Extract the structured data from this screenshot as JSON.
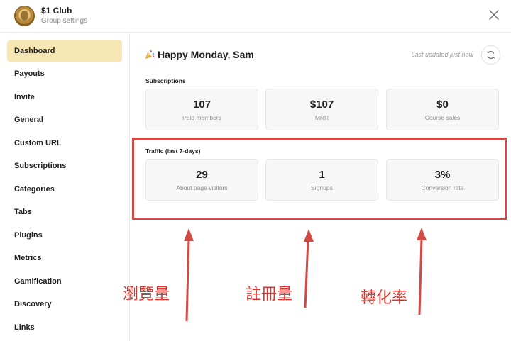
{
  "header": {
    "group_name": "$1 Club",
    "group_subtitle": "Group settings"
  },
  "sidebar": {
    "items": [
      {
        "label": "Dashboard",
        "active": true
      },
      {
        "label": "Payouts"
      },
      {
        "label": "Invite"
      },
      {
        "label": "General"
      },
      {
        "label": "Custom URL"
      },
      {
        "label": "Subscriptions"
      },
      {
        "label": "Categories"
      },
      {
        "label": "Tabs"
      },
      {
        "label": "Plugins"
      },
      {
        "label": "Metrics"
      },
      {
        "label": "Gamification"
      },
      {
        "label": "Discovery"
      },
      {
        "label": "Links"
      }
    ]
  },
  "main": {
    "greeting": "Happy Monday, Sam",
    "last_updated": "Last updated just now",
    "subscriptions": {
      "label": "Subscriptions",
      "cards": [
        {
          "value": "107",
          "label": "Paid members"
        },
        {
          "value": "$107",
          "label": "MRR"
        },
        {
          "value": "$0",
          "label": "Course sales"
        }
      ]
    },
    "traffic": {
      "label": "Traffic (last 7-days)",
      "cards": [
        {
          "value": "29",
          "label": "About page visitors"
        },
        {
          "value": "1",
          "label": "Signups"
        },
        {
          "value": "3%",
          "label": "Conversion rate"
        }
      ]
    }
  },
  "annotations": {
    "color": "#d9362f",
    "labels": [
      "瀏覽量",
      "註冊量",
      "轉化率"
    ]
  }
}
